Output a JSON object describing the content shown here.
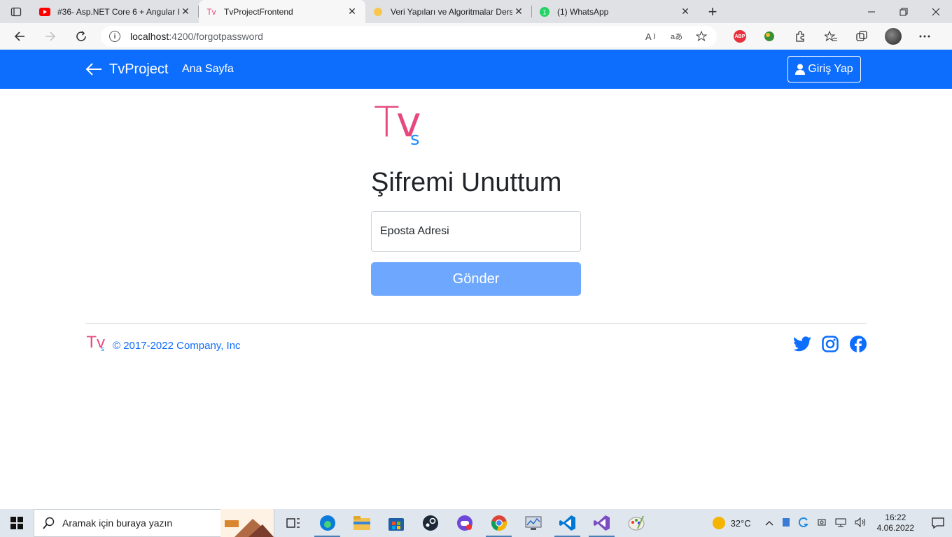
{
  "browser": {
    "tabs": [
      {
        "title": "#36- Asp.NET Core 6 + Angular I",
        "icon": "youtube-icon",
        "active": false
      },
      {
        "title": "TvProjectFrontend",
        "icon": "tv-logo-icon",
        "active": true
      },
      {
        "title": "Veri Yapıları ve Algoritmalar Ders",
        "icon": "circle-icon",
        "active": false
      },
      {
        "title": "(1) WhatsApp",
        "icon": "whatsapp-icon",
        "active": false
      }
    ],
    "url_host": "localhost",
    "url_path": ":4200/forgotpassword",
    "close_glyph": "✕",
    "new_tab_glyph": "+"
  },
  "header": {
    "brand": "TvProject",
    "nav_home": "Ana Sayfa",
    "login_label": "Giriş Yap",
    "bg_color": "#0d6efd"
  },
  "main": {
    "logo_t": "T",
    "logo_v": "v",
    "logo_s": "s",
    "title": "Şifremi Unuttum",
    "email_placeholder": "Eposta Adresi",
    "submit_label": "Gönder"
  },
  "footer": {
    "logo_t": "Tv",
    "logo_s": "s",
    "copyright": "© 2017-2022 Company, Inc",
    "social": [
      "twitter-icon",
      "instagram-icon",
      "facebook-icon"
    ]
  },
  "taskbar": {
    "search_placeholder": "Aramak için buraya yazın",
    "temperature": "32°C",
    "time": "16:22",
    "date": "4.06.2022"
  }
}
